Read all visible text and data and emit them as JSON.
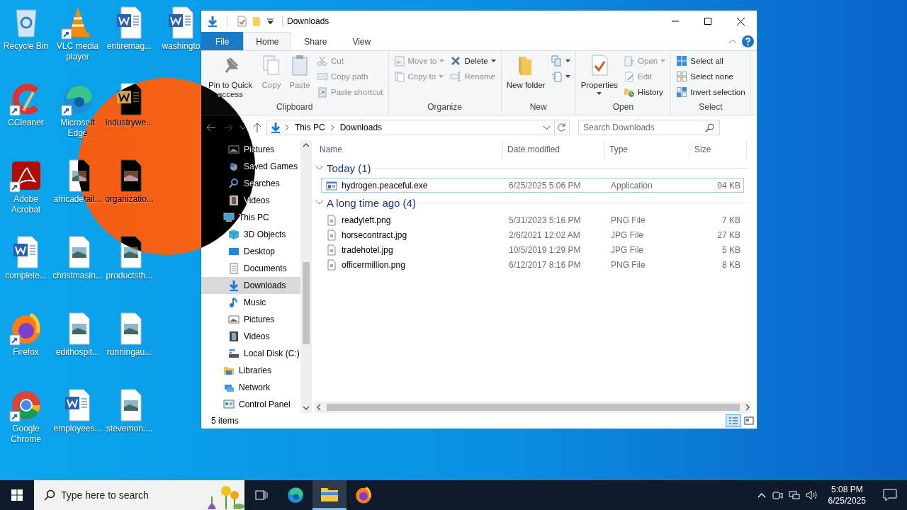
{
  "desktop_icons": [
    {
      "label": "Recycle Bin",
      "kind": "recycle",
      "shortcut": false
    },
    {
      "label": "CCleaner",
      "kind": "ccleaner",
      "shortcut": true
    },
    {
      "label": "Adobe Acrobat",
      "kind": "acrobat",
      "shortcut": true
    },
    {
      "label": "complete...",
      "kind": "word",
      "shortcut": false
    },
    {
      "label": "Firefox",
      "kind": "firefox",
      "shortcut": true
    },
    {
      "label": "Google Chrome",
      "kind": "chrome",
      "shortcut": true
    },
    {
      "label": "VLC media player",
      "kind": "vlc",
      "shortcut": true
    },
    {
      "label": "Microsoft Edge",
      "kind": "edge",
      "shortcut": true
    },
    {
      "label": "africadetail...",
      "kind": "image",
      "shortcut": false
    },
    {
      "label": "christmasin...",
      "kind": "image",
      "shortcut": false
    },
    {
      "label": "edithospit...",
      "kind": "image",
      "shortcut": false
    },
    {
      "label": "employees...",
      "kind": "word",
      "shortcut": false
    },
    {
      "label": "entiremag...",
      "kind": "word",
      "shortcut": false
    },
    {
      "label": "industrywe...",
      "kind": "word",
      "shortcut": false
    },
    {
      "label": "organizatio...",
      "kind": "image",
      "shortcut": false
    },
    {
      "label": "productsth...",
      "kind": "image",
      "shortcut": false
    },
    {
      "label": "runningau...",
      "kind": "image",
      "shortcut": false
    },
    {
      "label": "stevemon....",
      "kind": "image",
      "shortcut": false
    },
    {
      "label": "washingto",
      "kind": "word",
      "shortcut": false
    }
  ],
  "window": {
    "title": "Downloads",
    "ribbon_tabs": [
      {
        "label": "File",
        "kind": "file",
        "selected": false
      },
      {
        "label": "Home",
        "kind": "tab",
        "selected": true
      },
      {
        "label": "Share",
        "kind": "tab",
        "selected": false
      },
      {
        "label": "View",
        "kind": "tab",
        "selected": false
      }
    ],
    "ribbon_groups": [
      {
        "label": "Clipboard",
        "columns": [
          {
            "kind": "large",
            "items": [
              {
                "label": "Pin to Quick access",
                "disabled": false,
                "dropdown": false
              }
            ]
          },
          {
            "kind": "large",
            "items": [
              {
                "label": "Copy",
                "disabled": true,
                "dropdown": false
              }
            ]
          },
          {
            "kind": "large",
            "items": [
              {
                "label": "Paste",
                "disabled": true,
                "dropdown": false
              }
            ]
          },
          {
            "kind": "stack",
            "items": [
              {
                "label": "Cut",
                "disabled": true,
                "dropdown": false
              },
              {
                "label": "Copy path",
                "disabled": true,
                "dropdown": false
              },
              {
                "label": "Paste shortcut",
                "disabled": true,
                "dropdown": false
              }
            ]
          }
        ]
      },
      {
        "label": "Organize",
        "columns": [
          {
            "kind": "stack",
            "items": [
              {
                "label": "Move to",
                "disabled": true,
                "dropdown": true
              },
              {
                "label": "Copy to",
                "disabled": true,
                "dropdown": true
              }
            ]
          },
          {
            "kind": "stack",
            "items": [
              {
                "label": "Delete",
                "disabled": false,
                "dropdown": true
              },
              {
                "label": "Rename",
                "disabled": true,
                "dropdown": false
              }
            ]
          }
        ]
      },
      {
        "label": "New",
        "columns": [
          {
            "kind": "large",
            "items": [
              {
                "label": "New folder",
                "disabled": false,
                "dropdown": false
              }
            ]
          },
          {
            "kind": "stack",
            "items": [
              {
                "disabled": false,
                "dropdown": true
              },
              {
                "disabled": false,
                "dropdown": true
              }
            ]
          }
        ]
      },
      {
        "label": "Open",
        "columns": [
          {
            "kind": "large",
            "items": [
              {
                "label": "Properties",
                "disabled": false,
                "dropdown": true
              }
            ]
          },
          {
            "kind": "stack",
            "items": [
              {
                "label": "Open",
                "disabled": true,
                "dropdown": true
              },
              {
                "label": "Edit",
                "disabled": true,
                "dropdown": false
              },
              {
                "label": "History",
                "disabled": false,
                "dropdown": false
              }
            ]
          }
        ]
      },
      {
        "label": "Select",
        "columns": [
          {
            "kind": "stack",
            "items": [
              {
                "label": "Select all",
                "disabled": false,
                "dropdown": false
              },
              {
                "label": "Select none",
                "disabled": false,
                "dropdown": false
              },
              {
                "label": "Invert selection",
                "disabled": false,
                "dropdown": false
              }
            ]
          }
        ]
      }
    ],
    "path": [
      "This PC",
      "Downloads"
    ],
    "search": {
      "placeholder": "Search Downloads"
    },
    "navigation": {
      "continued_items": [
        {
          "label": "Pictures",
          "selected": false
        },
        {
          "label": "Saved Games",
          "selected": false
        },
        {
          "label": "Searches",
          "selected": false
        },
        {
          "label": "Videos",
          "selected": false
        }
      ],
      "tree": [
        {
          "label": "This PC",
          "selected": false,
          "children": [
            {
              "label": "3D Objects",
              "selected": false
            },
            {
              "label": "Desktop",
              "selected": false
            },
            {
              "label": "Documents",
              "selected": false
            },
            {
              "label": "Downloads",
              "selected": true
            },
            {
              "label": "Music",
              "selected": false
            },
            {
              "label": "Pictures",
              "selected": false
            },
            {
              "label": "Videos",
              "selected": false
            },
            {
              "label": "Local Disk (C:)",
              "selected": false
            }
          ]
        },
        {
          "label": "Libraries",
          "selected": false
        },
        {
          "label": "Network",
          "selected": false
        },
        {
          "label": "Control Panel",
          "selected": false
        }
      ]
    },
    "columns": [
      "Name",
      "Date modified",
      "Type",
      "Size"
    ],
    "groups": [
      {
        "label": "Today (1)",
        "expanded": true,
        "rows": [
          {
            "kind": "exe",
            "focused": true,
            "cells": [
              "hydrogen.peaceful.exe",
              "6/25/2025 5:06 PM",
              "Application",
              "94 KB"
            ]
          }
        ]
      },
      {
        "label": "A long time ago (4)",
        "expanded": true,
        "rows": [
          {
            "kind": "file",
            "focused": false,
            "cells": [
              "readyleft.png",
              "5/31/2023 5:16 PM",
              "PNG File",
              "7 KB"
            ]
          },
          {
            "kind": "file",
            "focused": false,
            "cells": [
              "horsecontract.jpg",
              "2/6/2021 12:02 AM",
              "JPG File",
              "27 KB"
            ]
          },
          {
            "kind": "file",
            "focused": false,
            "cells": [
              "tradehotel.jpg",
              "10/5/2019 1:29 PM",
              "JPG File",
              "5 KB"
            ]
          },
          {
            "kind": "file",
            "focused": false,
            "cells": [
              "officermillion.png",
              "6/12/2017 8:16 PM",
              "PNG File",
              "8 KB"
            ]
          }
        ]
      }
    ],
    "status": "5 items",
    "view_buttons": [
      {
        "kind": "details",
        "selected": true
      },
      {
        "kind": "tiles",
        "selected": false
      }
    ]
  },
  "taskbar": {
    "search_placeholder": "Type here to search",
    "apps": [
      {
        "kind": "taskview",
        "active": false
      },
      {
        "kind": "edge",
        "active": false
      },
      {
        "kind": "explorer",
        "active": true
      },
      {
        "kind": "firefox",
        "active": false
      }
    ],
    "time": "5:08 PM",
    "date": "6/25/2025"
  }
}
